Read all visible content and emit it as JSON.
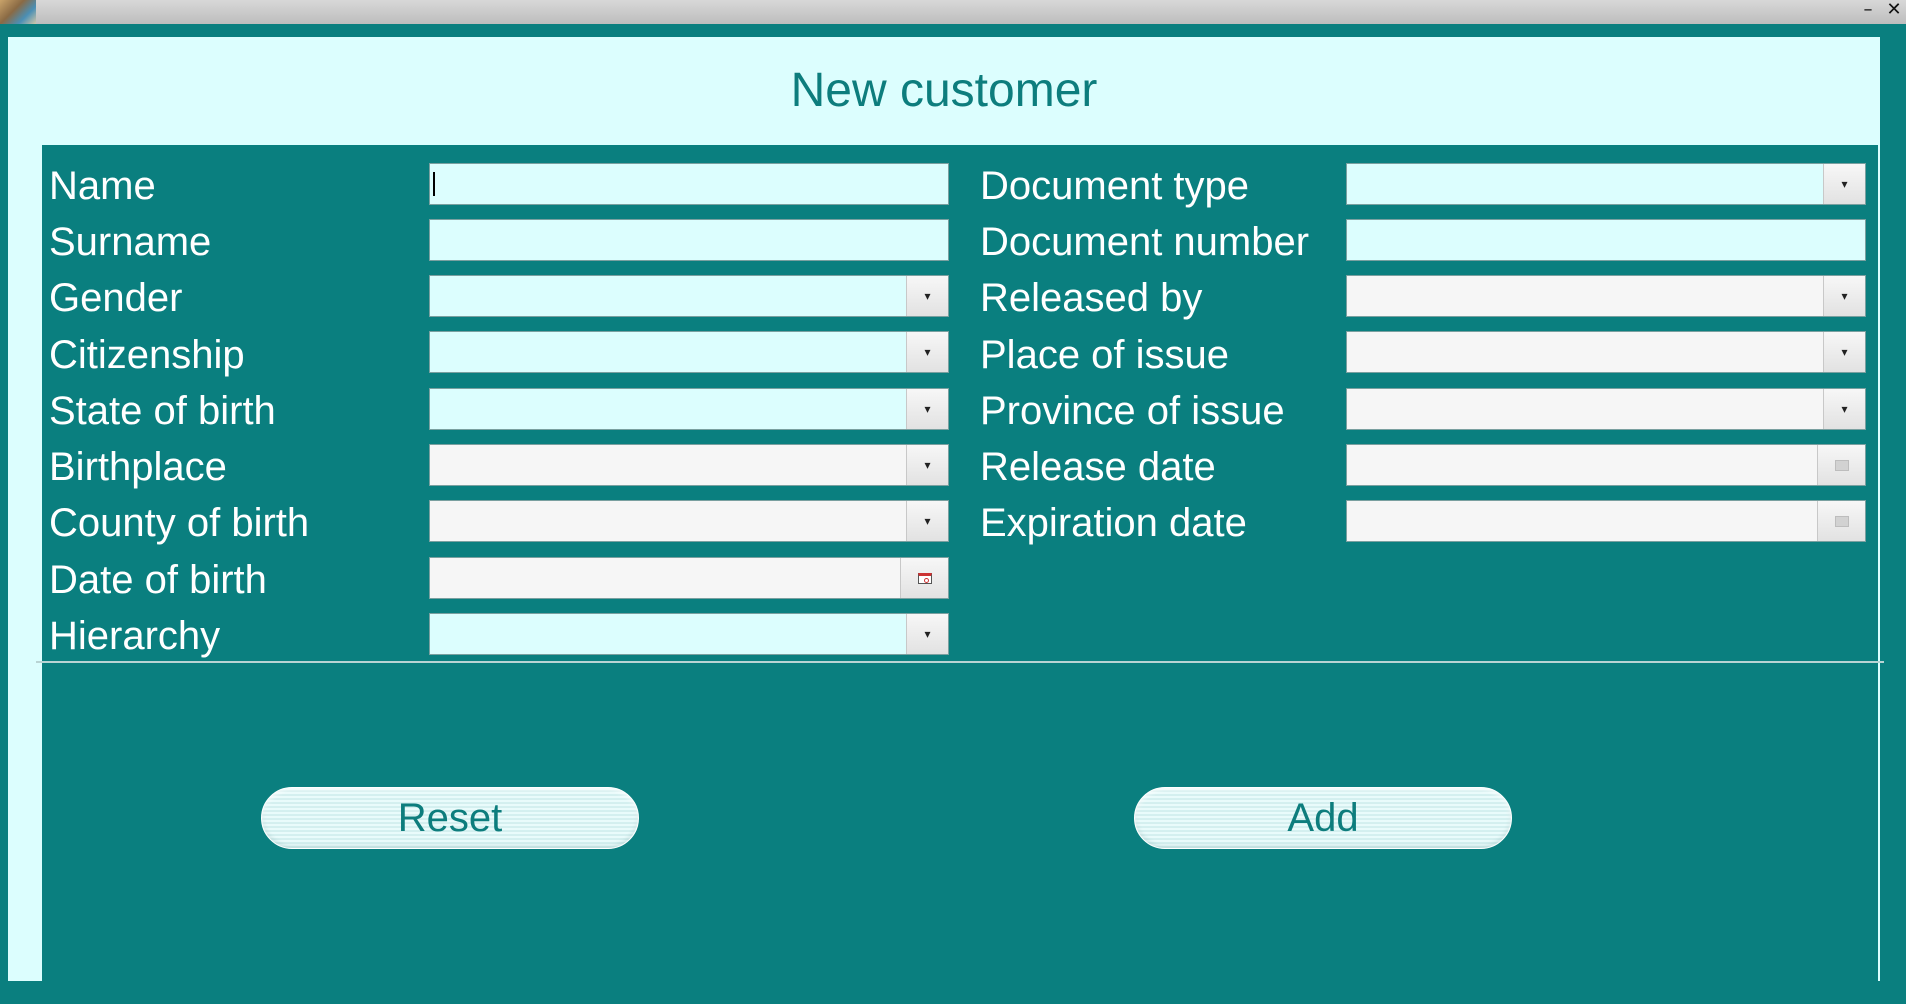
{
  "window": {
    "minimize_glyph": "–",
    "close_glyph": "✕",
    "icons": {
      "app": "app-icon",
      "minimize": "minimize-icon",
      "close": "close-icon"
    }
  },
  "form": {
    "title": "New customer",
    "left_fields": {
      "name": {
        "label": "Name",
        "value": ""
      },
      "surname": {
        "label": "Surname",
        "value": ""
      },
      "gender": {
        "label": "Gender",
        "value": ""
      },
      "citizenship": {
        "label": "Citizenship",
        "value": ""
      },
      "state_of_birth": {
        "label": "State of birth",
        "value": ""
      },
      "birthplace": {
        "label": "Birthplace",
        "value": ""
      },
      "county_of_birth": {
        "label": "County of birth",
        "value": ""
      },
      "date_of_birth": {
        "label": "Date of birth",
        "value": ""
      },
      "hierarchy": {
        "label": "Hierarchy",
        "value": ""
      }
    },
    "right_fields": {
      "document_type": {
        "label": "Document type",
        "value": ""
      },
      "document_number": {
        "label": "Document number",
        "value": ""
      },
      "released_by": {
        "label": "Released by",
        "value": ""
      },
      "place_of_issue": {
        "label": "Place of issue",
        "value": ""
      },
      "province_of_issue": {
        "label": "Province of issue",
        "value": ""
      },
      "release_date": {
        "label": "Release date",
        "value": ""
      },
      "expiration_date": {
        "label": "Expiration date",
        "value": ""
      }
    },
    "dropdown_glyph": "▾",
    "buttons": {
      "reset": "Reset",
      "add": "Add"
    }
  },
  "colors": {
    "teal_background": "#0a7f7f",
    "panel_background": "#dcfefe",
    "title_text": "#0d7d7d",
    "label_text": "#ffffff"
  }
}
